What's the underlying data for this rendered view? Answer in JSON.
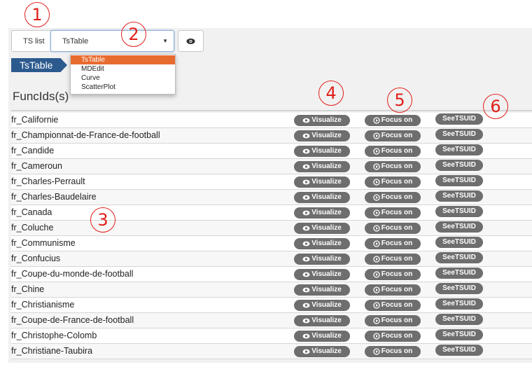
{
  "callouts": [
    "1",
    "2",
    "3",
    "4",
    "5",
    "6"
  ],
  "toolbar": {
    "ts_list_label": "TS list",
    "viz_selected": "TsTable",
    "eye_button": "view-icon"
  },
  "breadcrumb": {
    "label": "TsTable"
  },
  "dropdown": {
    "options": [
      "TsTable",
      "MDEdit",
      "Curve",
      "ScatterPlot"
    ],
    "selected": "TsTable"
  },
  "table": {
    "title": "FuncIds(s)",
    "actions": {
      "visualize": "Visualize",
      "focus": "Focus on",
      "see": "SeeTSUID"
    },
    "rows": [
      "fr_Californie",
      "fr_Championnat-de-France-de-football",
      "fr_Candide",
      "fr_Cameroun",
      "fr_Charles-Perrault",
      "fr_Charles-Baudelaire",
      "fr_Canada",
      "fr_Coluche",
      "fr_Communisme",
      "fr_Confucius",
      "fr_Coupe-du-monde-de-football",
      "fr_Chine",
      "fr_Christianisme",
      "fr_Coupe-de-France-de-football",
      "fr_Christophe-Colomb",
      "fr_Christiane-Taubira"
    ]
  },
  "colors": {
    "accent": "#2c5a8e",
    "selected_option": "#e76b2f",
    "callout": "#e0201b",
    "pill": "#6e6e6e"
  }
}
